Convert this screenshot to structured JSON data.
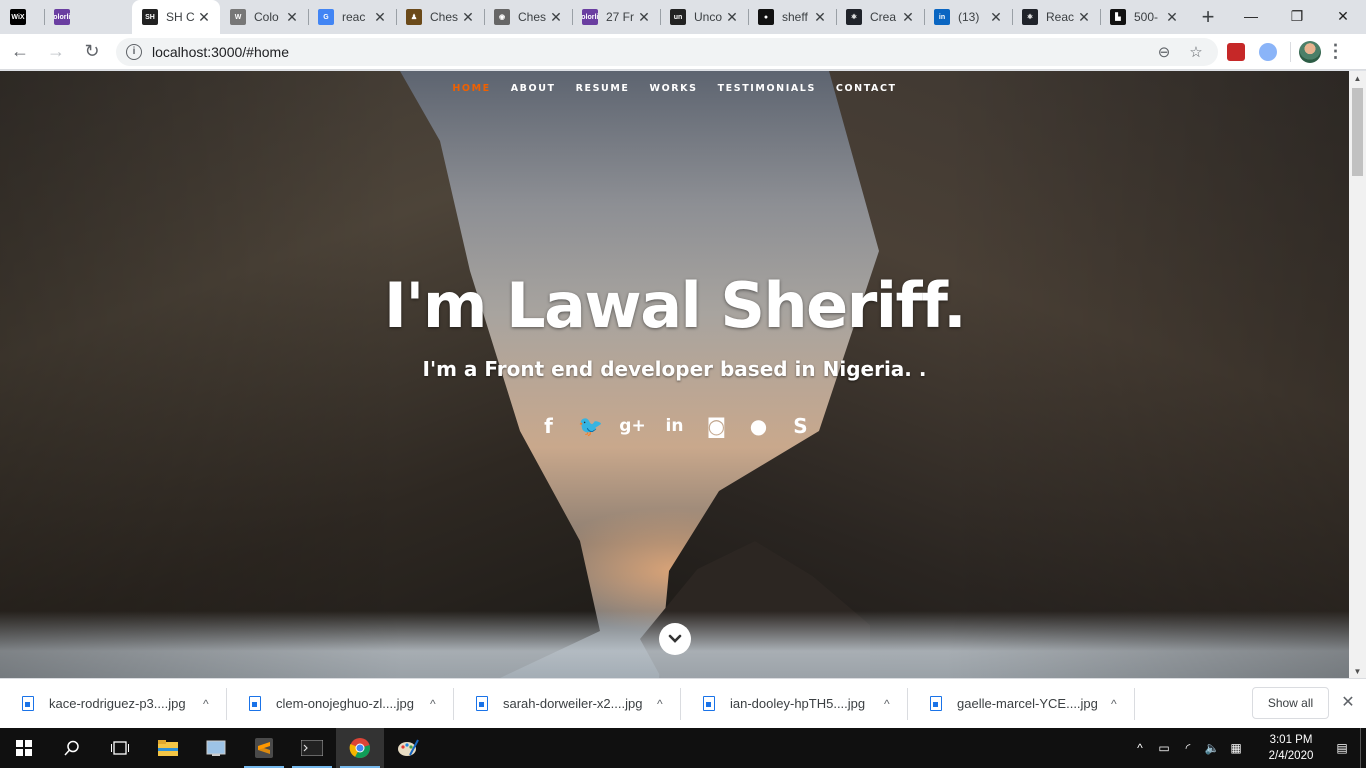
{
  "browser": {
    "tabs": [
      {
        "title": "",
        "favicon": "wix",
        "favicon_text": "WiX",
        "color": "#000000"
      },
      {
        "title": "",
        "favicon": "colorlib",
        "favicon_text": "colorlib",
        "color": "#6a3ea1"
      },
      {
        "title": "SH C",
        "favicon": "sh",
        "favicon_text": "SH",
        "color": "#222222",
        "active": true
      },
      {
        "title": "Colo",
        "favicon": "wordpress",
        "favicon_text": "W",
        "color": "#777777"
      },
      {
        "title": "reac",
        "favicon": "google",
        "favicon_text": "G",
        "color": "#4285f4"
      },
      {
        "title": "Ches",
        "favicon": "chess-book",
        "favicon_text": "♟",
        "color": "#6b4a1a"
      },
      {
        "title": "Ches",
        "favicon": "globe",
        "favicon_text": "◉",
        "color": "#666666"
      },
      {
        "title": "27 Fr",
        "favicon": "colorlib",
        "favicon_text": "colorlib",
        "color": "#6a3ea1"
      },
      {
        "title": "Unco",
        "favicon": "undesign",
        "favicon_text": "un",
        "color": "#222222"
      },
      {
        "title": "sheff",
        "favicon": "github",
        "favicon_text": "●",
        "color": "#111111"
      },
      {
        "title": "Crea",
        "favicon": "react",
        "favicon_text": "⚛",
        "color": "#20232a"
      },
      {
        "title": "(13)",
        "favicon": "linkedin",
        "favicon_text": "in",
        "color": "#0a66c2"
      },
      {
        "title": "Reac",
        "favicon": "react",
        "favicon_text": "⚛",
        "color": "#20232a"
      },
      {
        "title": "500-",
        "favicon": "500px",
        "favicon_text": "▙",
        "color": "#111111"
      }
    ],
    "new_tab_label": "+",
    "window_controls": {
      "minimize": "—",
      "restore": "❐",
      "close": "✕"
    },
    "nav": {
      "back": "←",
      "forward": "→",
      "reload": "↻"
    },
    "address": "localhost:3000/#home",
    "address_icons": {
      "info": "i",
      "zoom": "⊖",
      "bookmark": "☆"
    },
    "menu": "⋮"
  },
  "site": {
    "nav": [
      {
        "label": "HOME",
        "current": true
      },
      {
        "label": "ABOUT"
      },
      {
        "label": "RESUME"
      },
      {
        "label": "WORKS"
      },
      {
        "label": "TESTIMONIALS"
      },
      {
        "label": "CONTACT"
      }
    ],
    "headline": "I'm Lawal Sheriff.",
    "subline": "I'm a Front end developer based in Nigeria. .",
    "social": [
      {
        "name": "facebook-icon",
        "glyph": "f"
      },
      {
        "name": "twitter-icon",
        "glyph": "🐦"
      },
      {
        "name": "google-plus-icon",
        "glyph": "g+"
      },
      {
        "name": "linkedin-icon",
        "glyph": "in"
      },
      {
        "name": "instagram-icon",
        "glyph": "◙"
      },
      {
        "name": "github-icon",
        "glyph": "●"
      },
      {
        "name": "skype-icon",
        "glyph": "S"
      }
    ],
    "accent": "#f06000"
  },
  "downloads": {
    "items": [
      {
        "name": "kace-rodriguez-p3....jpg"
      },
      {
        "name": "clem-onojeghuo-zl....jpg"
      },
      {
        "name": "sarah-dorweiler-x2....jpg"
      },
      {
        "name": "ian-dooley-hpTH5....jpg"
      },
      {
        "name": "gaelle-marcel-YCE....jpg"
      }
    ],
    "show_all": "Show all",
    "close": "✕"
  },
  "taskbar": {
    "time": "3:01 PM",
    "date": "2/4/2020",
    "apps": [
      "start",
      "search",
      "task-view",
      "file-explorer",
      "control-panel",
      "sublime-text",
      "terminal",
      "chrome",
      "paint"
    ]
  }
}
